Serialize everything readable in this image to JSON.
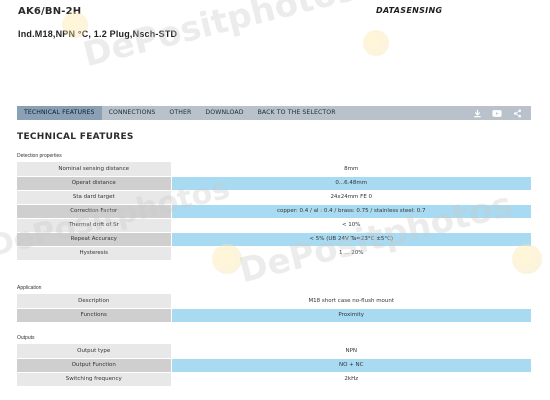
{
  "product": {
    "model_code": "AK6/BN-2H",
    "description": "Ind.M18,NPN      °C, 1.2 Plug,Nsch-STD"
  },
  "brand": {
    "logo_text": "DATASENSING"
  },
  "nav": {
    "tabs": [
      {
        "label": "TECHNICAL FEATURES",
        "active": true
      },
      {
        "label": "CONNECTIONS",
        "active": false
      },
      {
        "label": "OTHER",
        "active": false
      },
      {
        "label": "DOWNLOAD",
        "active": false
      },
      {
        "label": "BACK TO THE SELECTOR",
        "active": false
      }
    ],
    "icons": [
      "download-icon",
      "youtube-icon",
      "share-icon"
    ]
  },
  "section_title": "TECHNICAL FEATURES",
  "groups": [
    {
      "label": "Detection properties",
      "rows": [
        {
          "key": "Nominal sensing distance",
          "value": "8mm"
        },
        {
          "key": "Operat    distance",
          "value": "0...6.48mm"
        },
        {
          "key": "Sta   dard target",
          "value": "24x24mm FE   0"
        },
        {
          "key": "Correction Factor",
          "value": "copper: 0.4 / al      : 0.4 / brass: 0.75 / stainless steel: 0.7"
        },
        {
          "key": "Thermal drift of Sr",
          "value": "< 10%"
        },
        {
          "key": "Repeat Accuracy",
          "value": "< 5% (UB 24V Ta=23°C ±5°C)"
        },
        {
          "key": "Hysteresis",
          "value": "1 ... 20%"
        }
      ]
    },
    {
      "label": "Application",
      "rows": [
        {
          "key": "Description",
          "value": "M18 short case no-flush mount"
        },
        {
          "key": "Functions",
          "value": "Proximity"
        }
      ]
    },
    {
      "label": "Outputs",
      "rows": [
        {
          "key": "Output type",
          "value": "NPN"
        },
        {
          "key": "Output Function",
          "value": "NO + NC"
        },
        {
          "key": "Switching frequency",
          "value": "2kHz"
        }
      ]
    }
  ],
  "watermark_text": "DePositphotos",
  "colors": {
    "nav_bg": "#b9c2cb",
    "nav_active": "#8aa0b5",
    "row_highlight": "#a8daf2",
    "row_key_dark": "#cfcfcf",
    "row_key_light": "#e8e8e8"
  }
}
